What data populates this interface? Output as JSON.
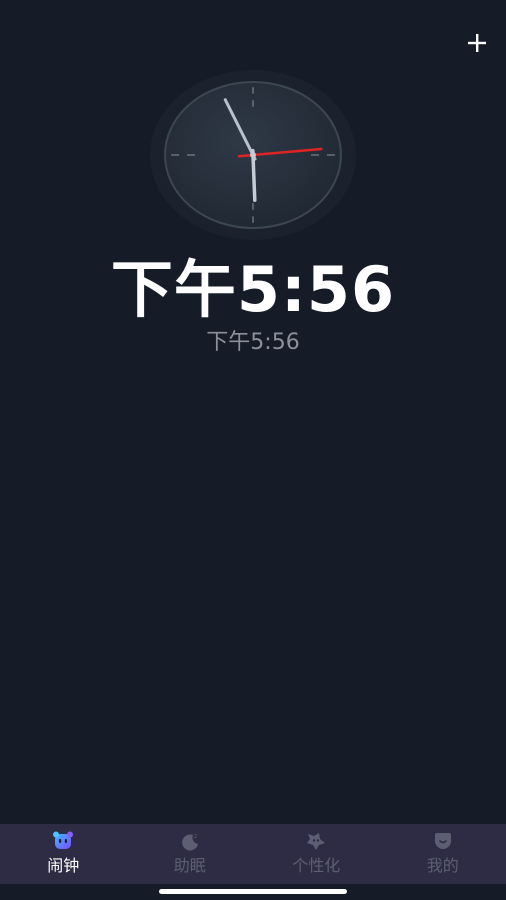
{
  "header": {
    "add_icon": "plus-icon"
  },
  "clock": {
    "hour": 5,
    "minute": 56,
    "second": 14,
    "second_hand_color": "#e02424"
  },
  "time": {
    "main": "下午5:56",
    "sub": "下午5:56"
  },
  "tabbar": {
    "active_color": "#ffffff",
    "inactive_color": "#5e5e72",
    "items": [
      {
        "label": "闹钟",
        "icon": "alarm-clock-icon",
        "active": true
      },
      {
        "label": "助眠",
        "icon": "moon-icon",
        "active": false
      },
      {
        "label": "个性化",
        "icon": "personalize-icon",
        "active": false
      },
      {
        "label": "我的",
        "icon": "profile-icon",
        "active": false
      }
    ]
  }
}
